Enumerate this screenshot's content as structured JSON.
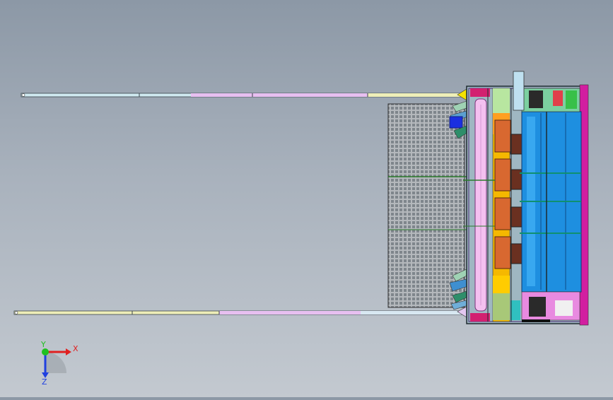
{
  "view": {
    "background_top": "#8c98a6",
    "background_bottom": "#c3c9d0"
  },
  "triad": {
    "x_label": "X",
    "y_label": "Y",
    "z_label": "Z",
    "x_color": "#e02020",
    "y_color": "#20c020",
    "z_color": "#2040e0"
  },
  "icons": [
    "orientation-triad-icon"
  ]
}
